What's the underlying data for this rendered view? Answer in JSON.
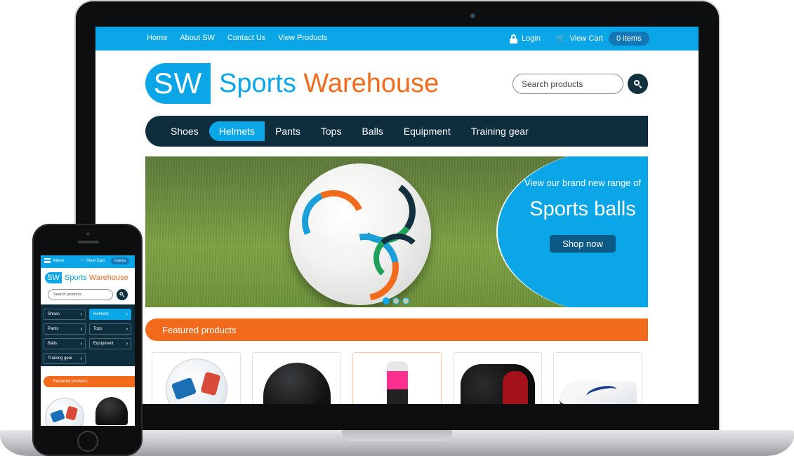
{
  "desktop": {
    "topbar": {
      "links": [
        "Home",
        "About SW",
        "Contact Us",
        "View Products"
      ],
      "login": "Login",
      "view_cart": "View Cart",
      "cart_items": "0 items"
    },
    "logo": {
      "badge": "SW",
      "word1": "Sports",
      "word2": "Warehouse"
    },
    "search": {
      "placeholder": "Search products"
    },
    "categories": [
      "Shoes",
      "Helmets",
      "Pants",
      "Tops",
      "Balls",
      "Equipment",
      "Training gear"
    ],
    "active_category": "Helmets",
    "hero": {
      "subtitle": "View our brand new range of",
      "title": "Sports balls",
      "button": "Shop now"
    },
    "featured_heading": "Featured products",
    "products": [
      "ball",
      "helmet",
      "bottle",
      "gloves",
      "shoe"
    ]
  },
  "mobile": {
    "menu": "Menu",
    "view_cart": "View Cart",
    "cart_items": "0 items",
    "logo": {
      "badge": "SW",
      "word1": "Sports",
      "word2": "Warehouse"
    },
    "search": {
      "placeholder": "Search products"
    },
    "categories": [
      "Shoes",
      "Helmets",
      "Pants",
      "Tops",
      "Balls",
      "Equipment",
      "Training gear"
    ],
    "featured_heading": "Featured products"
  },
  "colors": {
    "brand_blue": "#0aa6e8",
    "brand_orange": "#f26b1d",
    "dark_navy": "#0e2e3d"
  }
}
